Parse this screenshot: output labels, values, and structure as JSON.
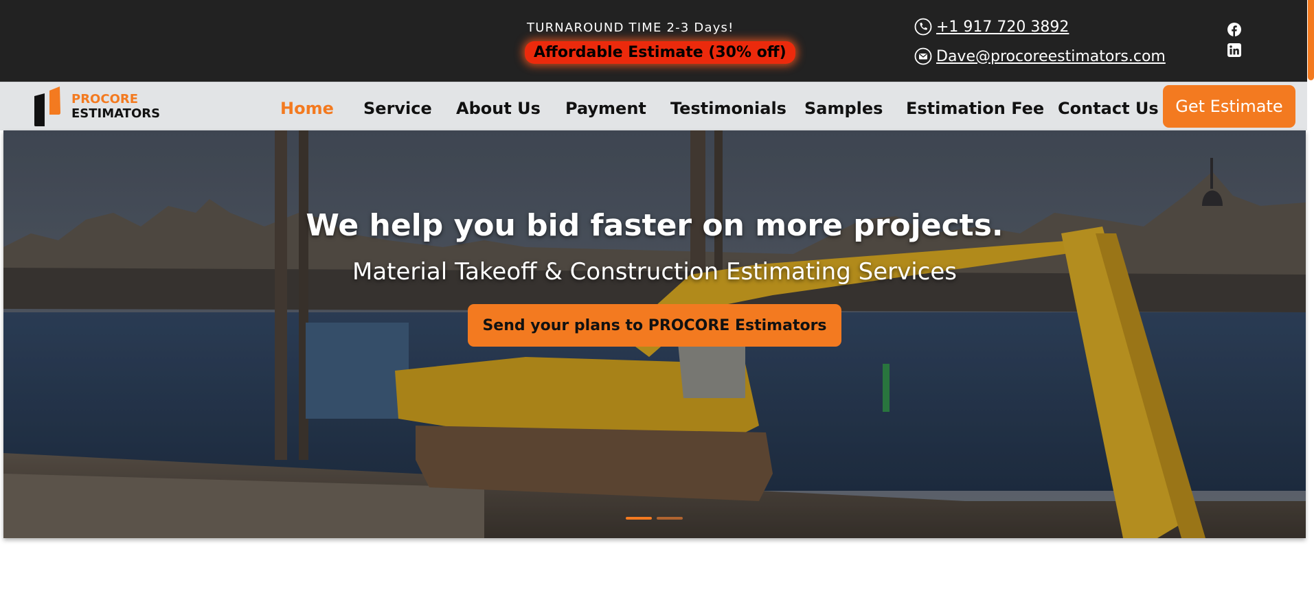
{
  "topbar": {
    "turnaround": "TURNAROUND TIME 2-3 Days!",
    "promo": "Affordable Estimate (30% off)",
    "phone": "+1 917 720 3892",
    "email": "Dave@procoreestimators.com",
    "phone_icon": "phone-icon",
    "email_icon": "mail-icon",
    "social": [
      "facebook-icon",
      "linkedin-icon"
    ]
  },
  "brand": {
    "line1": "PROCORE",
    "line2": "ESTIMATORS",
    "accent": "#f37a20"
  },
  "nav": {
    "items": [
      {
        "label": "Home",
        "active": true
      },
      {
        "label": "Service"
      },
      {
        "label": "About Us"
      },
      {
        "label": "Payment"
      },
      {
        "label": "Testimonials"
      },
      {
        "label": "Samples"
      },
      {
        "label": "Estimation Fee"
      },
      {
        "label": "Contact Us"
      }
    ],
    "cta": "Get Estimate"
  },
  "hero": {
    "title": "We help you bid faster on more projects.",
    "subtitle": "Material Takeoff & Construction Estimating Services",
    "cta": "Send your plans to PROCORE Estimators",
    "slides": 2,
    "active_slide": 1
  }
}
